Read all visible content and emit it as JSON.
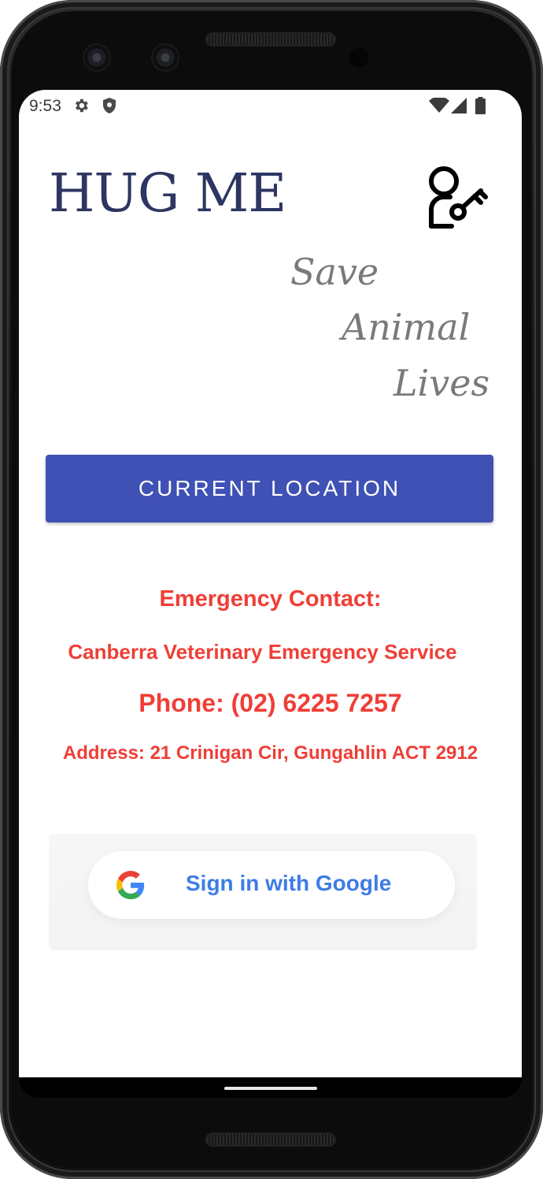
{
  "status_bar": {
    "time": "9:53",
    "icons": [
      "gear-icon",
      "shield-icon",
      "wifi-icon",
      "cellular-signal-icon",
      "battery-icon"
    ]
  },
  "app": {
    "title": "HUG ME",
    "admin_icon": "user-key-icon",
    "tagline": [
      "Save",
      "Animal",
      "Lives"
    ]
  },
  "current_location_button": {
    "label": "CURRENT LOCATION"
  },
  "emergency": {
    "heading": "Emergency Contact:",
    "name": "Canberra Veterinary Emergency Service",
    "phone": "Phone: (02) 6225 7257",
    "address": "Address: 21 Crinigan Cir, Gungahlin ACT 2912"
  },
  "google_sign_in": {
    "label": "Sign in with Google",
    "icon": "google-g-icon"
  },
  "colors": {
    "primary": "#3f51b5",
    "title": "#2d3561",
    "emergency_text": "#ef3e36",
    "google_text": "#3d7ce6"
  }
}
